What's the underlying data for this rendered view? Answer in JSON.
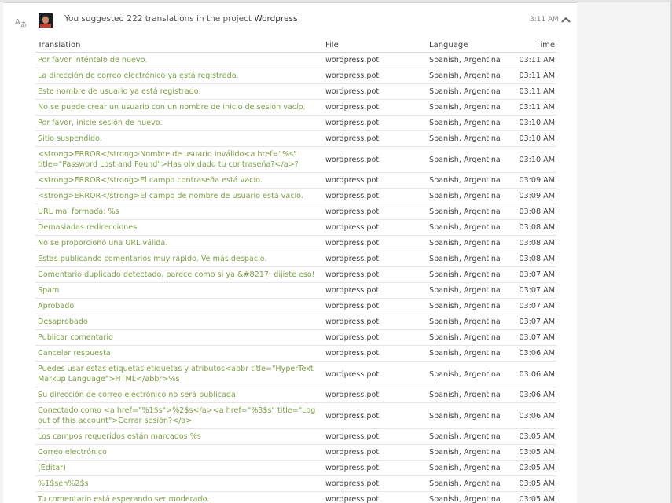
{
  "activity": {
    "headline_prefix": "You suggested 222 translations in the project",
    "project": "Wordpress",
    "time": "3:11 AM"
  },
  "table": {
    "headers": [
      "Translation",
      "File",
      "Language",
      "Time"
    ],
    "rows": [
      {
        "translation": "Por favor inténtalo de nuevo.",
        "file": "wordpress.pot",
        "language": "Spanish, Argentina",
        "time": "03:11 AM"
      },
      {
        "translation": "La dirección de correo electrónico ya está registrada.",
        "file": "wordpress.pot",
        "language": "Spanish, Argentina",
        "time": "03:11 AM"
      },
      {
        "translation": "Este nombre de usuario ya está registrado.",
        "file": "wordpress.pot",
        "language": "Spanish, Argentina",
        "time": "03:11 AM"
      },
      {
        "translation": "No se puede crear un usuario con un nombre de inicio de sesión vacío.",
        "file": "wordpress.pot",
        "language": "Spanish, Argentina",
        "time": "03:11 AM"
      },
      {
        "translation": "Por favor, inicie sesión de nuevo.",
        "file": "wordpress.pot",
        "language": "Spanish, Argentina",
        "time": "03:10 AM"
      },
      {
        "translation": "Sitio suspendido.",
        "file": "wordpress.pot",
        "language": "Spanish, Argentina",
        "time": "03:10 AM"
      },
      {
        "translation": "<strong>ERROR</strong>Nombre de usuario inválido<a href=\"%s\" title=\"Password Lost and Found\">Has olvidado tu contraseña?</a>?",
        "file": "wordpress.pot",
        "language": "Spanish, Argentina",
        "time": "03:10 AM",
        "tall": true
      },
      {
        "translation": "<strong>ERROR</strong>El campo contraseña está vacío.",
        "file": "wordpress.pot",
        "language": "Spanish, Argentina",
        "time": "03:09 AM"
      },
      {
        "translation": "<strong>ERROR</strong>El campo de nombre de usuario está vacío.",
        "file": "wordpress.pot",
        "language": "Spanish, Argentina",
        "time": "03:09 AM"
      },
      {
        "translation": "URL mal formada: %s",
        "file": "wordpress.pot",
        "language": "Spanish, Argentina",
        "time": "03:08 AM"
      },
      {
        "translation": "Demasiadas redirecciones.",
        "file": "wordpress.pot",
        "language": "Spanish, Argentina",
        "time": "03:08 AM"
      },
      {
        "translation": "No se proporcionó una URL válida.",
        "file": "wordpress.pot",
        "language": "Spanish, Argentina",
        "time": "03:08 AM"
      },
      {
        "translation": "Estas publicando comentarios muy rápido. Ve más despacio.",
        "file": "wordpress.pot",
        "language": "Spanish, Argentina",
        "time": "03:08 AM"
      },
      {
        "translation": "Comentario duplicado detectado, parece como si ya &#8217; dijiste eso!",
        "file": "wordpress.pot",
        "language": "Spanish, Argentina",
        "time": "03:07 AM"
      },
      {
        "translation": "Spam",
        "file": "wordpress.pot",
        "language": "Spanish, Argentina",
        "time": "03:07 AM"
      },
      {
        "translation": "Aprobado",
        "file": "wordpress.pot",
        "language": "Spanish, Argentina",
        "time": "03:07 AM"
      },
      {
        "translation": "Desaprobado",
        "file": "wordpress.pot",
        "language": "Spanish, Argentina",
        "time": "03:07 AM"
      },
      {
        "translation": "Publicar comentario",
        "file": "wordpress.pot",
        "language": "Spanish, Argentina",
        "time": "03:07 AM"
      },
      {
        "translation": "Cancelar respuesta",
        "file": "wordpress.pot",
        "language": "Spanish, Argentina",
        "time": "03:06 AM"
      },
      {
        "translation": "Puedes usar estas etiquetas etiquetas y atributos<abbr title=\"HyperText Markup Language\">HTML</abbr>%s",
        "file": "wordpress.pot",
        "language": "Spanish, Argentina",
        "time": "03:06 AM",
        "tall": true
      },
      {
        "translation": "Su dirección de correo electrónico no será publicada.",
        "file": "wordpress.pot",
        "language": "Spanish, Argentina",
        "time": "03:06 AM"
      },
      {
        "translation": "Conectado como <a href=\"%1$s\">%2$s</a><a href=\"%3$s\" title=\"Log out of this account\">Cerrar sesión?</a>",
        "file": "wordpress.pot",
        "language": "Spanish, Argentina",
        "time": "03:06 AM",
        "tall": true
      },
      {
        "translation": "Los campos requeridos están marcados %s",
        "file": "wordpress.pot",
        "language": "Spanish, Argentina",
        "time": "03:05 AM"
      },
      {
        "translation": "Correo electrónico",
        "file": "wordpress.pot",
        "language": "Spanish, Argentina",
        "time": "03:05 AM"
      },
      {
        "translation": "(Editar)",
        "file": "wordpress.pot",
        "language": "Spanish, Argentina",
        "time": "03:05 AM"
      },
      {
        "translation": "%1$sen%2$s",
        "file": "wordpress.pot",
        "language": "Spanish, Argentina",
        "time": "03:05 AM"
      },
      {
        "translation": "Tu comentario está esperando ser moderado.",
        "file": "wordpress.pot",
        "language": "Spanish, Argentina",
        "time": "03:05 AM"
      }
    ]
  },
  "icons": {
    "activity": "translate-icon",
    "collapse": "chevron-up-icon"
  },
  "colors": {
    "translation_text": "#7da046",
    "body_text": "#444444"
  }
}
